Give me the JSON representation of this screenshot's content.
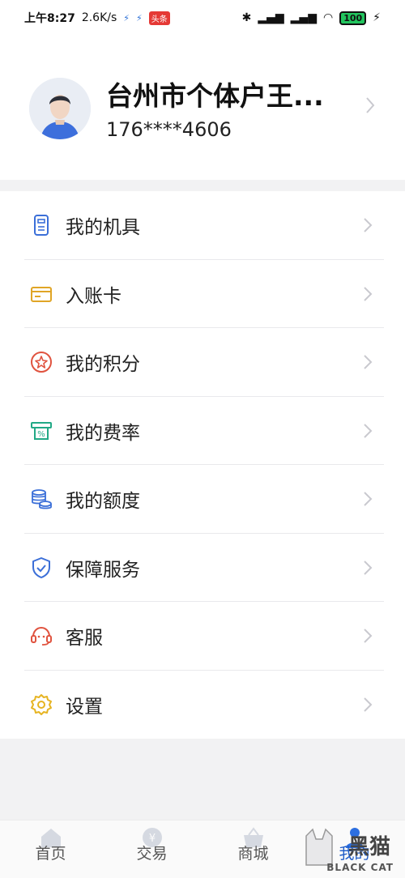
{
  "status_bar": {
    "time": "上午8:27",
    "speed": "2.6K/s",
    "badge": "头条",
    "battery": "100"
  },
  "profile": {
    "name": "台州市个体户王...",
    "phone": "176****4606"
  },
  "menu": {
    "items": [
      {
        "label": "我的机具",
        "icon": "device-icon",
        "color": "#3b6fd8"
      },
      {
        "label": "入账卡",
        "icon": "card-icon",
        "color": "#e0a526"
      },
      {
        "label": "我的积分",
        "icon": "star-icon",
        "color": "#e0533f"
      },
      {
        "label": "我的费率",
        "icon": "rate-icon",
        "color": "#22a986"
      },
      {
        "label": "我的额度",
        "icon": "coins-icon",
        "color": "#3b6fd8"
      },
      {
        "label": "保障服务",
        "icon": "shield-icon",
        "color": "#3b6fd8"
      },
      {
        "label": "客服",
        "icon": "headset-icon",
        "color": "#e0533f"
      },
      {
        "label": "设置",
        "icon": "gear-icon",
        "color": "#e6b422"
      }
    ]
  },
  "tabbar": {
    "tabs": [
      {
        "label": "首页",
        "icon": "home-icon"
      },
      {
        "label": "交易",
        "icon": "yen-icon"
      },
      {
        "label": "商城",
        "icon": "basket-icon"
      },
      {
        "label": "我的",
        "icon": "user-icon",
        "active": true
      }
    ],
    "active_color": "#1e5cc8"
  },
  "watermark": {
    "big": "黑猫",
    "small": "BLACK CAT"
  }
}
